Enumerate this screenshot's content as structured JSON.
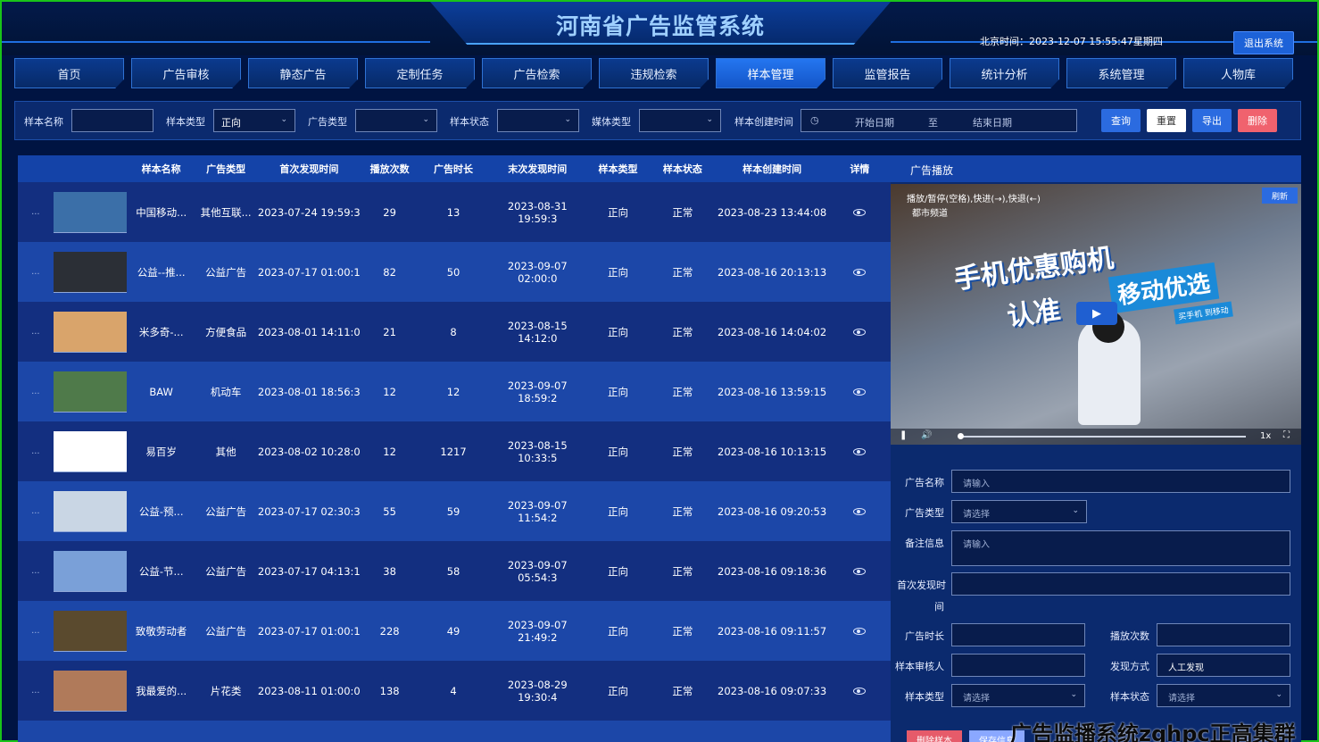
{
  "header": {
    "title": "河南省广告监管系统",
    "clock": "北京时间：2023-12-07 15:55:47星期四",
    "logout_label": "退出系统"
  },
  "nav": [
    "首页",
    "广告审核",
    "静态广告",
    "定制任务",
    "广告检索",
    "违规检索",
    "样本管理",
    "监管报告",
    "统计分析",
    "系统管理",
    "人物库"
  ],
  "nav_active": "样本管理",
  "filter": {
    "sample_name_label": "样本名称",
    "sample_type_label": "样本类型",
    "sample_type_value": "正向",
    "ad_type_label": "广告类型",
    "sample_status_label": "样本状态",
    "media_type_label": "媒体类型",
    "created_time_label": "样本创建时间",
    "start_placeholder": "开始日期",
    "range_sep": "至",
    "end_placeholder": "结束日期",
    "query": "查询",
    "reset": "重置",
    "export": "导出",
    "delete": "删除"
  },
  "table": {
    "headers": [
      "样本名称",
      "广告类型",
      "首次发现时间",
      "播放次数",
      "广告时长",
      "末次发现时间",
      "样本类型",
      "样本状态",
      "样本创建时间",
      "详情"
    ],
    "rows": [
      {
        "name": "中国移动...",
        "type": "其他互联...",
        "first": "2023-07-24 19:59:3",
        "plays": "29",
        "duration": "13",
        "last": "2023-08-31 19:59:3",
        "stype": "正向",
        "status": "正常",
        "created": "2023-08-23 13:44:08",
        "thumb": "#3b6fa8"
      },
      {
        "name": "公益--推...",
        "type": "公益广告",
        "first": "2023-07-17 01:00:1",
        "plays": "82",
        "duration": "50",
        "last": "2023-09-07 02:00:0",
        "stype": "正向",
        "status": "正常",
        "created": "2023-08-16 20:13:13",
        "thumb": "#2b2f36"
      },
      {
        "name": "米多奇-...",
        "type": "方便食品",
        "first": "2023-08-01 14:11:0",
        "plays": "21",
        "duration": "8",
        "last": "2023-08-15 14:12:0",
        "stype": "正向",
        "status": "正常",
        "created": "2023-08-16 14:04:02",
        "thumb": "#d9a46b"
      },
      {
        "name": "BAW",
        "type": "机动车",
        "first": "2023-08-01 18:56:3",
        "plays": "12",
        "duration": "12",
        "last": "2023-09-07 18:59:2",
        "stype": "正向",
        "status": "正常",
        "created": "2023-08-16 13:59:15",
        "thumb": "#4f7a4a"
      },
      {
        "name": "易百岁",
        "type": "其他",
        "first": "2023-08-02 10:28:0",
        "plays": "12",
        "duration": "1217",
        "last": "2023-08-15 10:33:5",
        "stype": "正向",
        "status": "正常",
        "created": "2023-08-16 10:13:15",
        "thumb": "#ffffff"
      },
      {
        "name": "公益-预...",
        "type": "公益广告",
        "first": "2023-07-17 02:30:3",
        "plays": "55",
        "duration": "59",
        "last": "2023-09-07 11:54:2",
        "stype": "正向",
        "status": "正常",
        "created": "2023-08-16 09:20:53",
        "thumb": "#c9d6e4"
      },
      {
        "name": "公益-节...",
        "type": "公益广告",
        "first": "2023-07-17 04:13:1",
        "plays": "38",
        "duration": "58",
        "last": "2023-09-07 05:54:3",
        "stype": "正向",
        "status": "正常",
        "created": "2023-08-16 09:18:36",
        "thumb": "#7aa0d8"
      },
      {
        "name": "致敬劳动者",
        "type": "公益广告",
        "first": "2023-07-17 01:00:1",
        "plays": "228",
        "duration": "49",
        "last": "2023-09-07 21:49:2",
        "stype": "正向",
        "status": "正常",
        "created": "2023-08-16 09:11:57",
        "thumb": "#5a4a2e"
      },
      {
        "name": "我最爱的...",
        "type": "片花类",
        "first": "2023-08-11 01:00:0",
        "plays": "138",
        "duration": "4",
        "last": "2023-08-29 19:30:4",
        "stype": "正向",
        "status": "正常",
        "created": "2023-08-16 09:07:33",
        "thumb": "#b07a5a"
      }
    ],
    "ellipsis": "..."
  },
  "panel": {
    "title": "广告播放",
    "video_caption": "播放/暂停(空格),快进(→),快退(←)",
    "video_logo": "都市频道",
    "refresh": "刷新",
    "headline1": "手机优惠购机",
    "headline2": "认准",
    "badge": "移动优选",
    "badge_sub": "买手机 到移动",
    "speed": "1x",
    "form": {
      "ad_name_label": "广告名称",
      "ad_name_ph": "请输入",
      "ad_type_label": "广告类型",
      "ad_type_ph": "请选择",
      "remark_label": "备注信息",
      "remark_ph": "请输入",
      "first_time_label": "首次发现时",
      "first_time_label2": "间",
      "duration_label": "广告时长",
      "plays_label": "播放次数",
      "reviewer_label": "样本审核人",
      "discover_label": "发现方式",
      "discover_value": "人工发现",
      "stype_label": "样本类型",
      "stype_ph": "请选择",
      "sstatus_label": "样本状态",
      "sstatus_ph": "请选择"
    },
    "btn_delete": "删除样本",
    "btn_save": "保存信息"
  },
  "watermark": "广告监播系统zghpc正高集群"
}
